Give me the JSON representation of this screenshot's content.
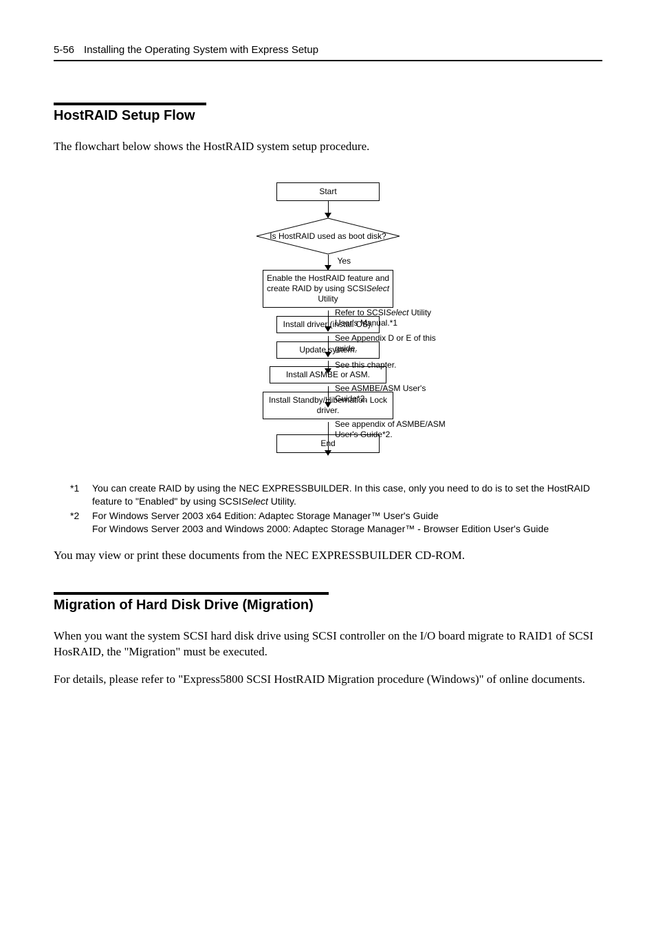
{
  "header": {
    "page_number": "5-56",
    "title": "Installing the Operating System with Express Setup"
  },
  "section1": {
    "heading": "HostRAID Setup Flow",
    "intro": "The flowchart below shows the HostRAID system setup procedure."
  },
  "chart_data": {
    "type": "flowchart",
    "nodes": {
      "start": "Start",
      "decision": "Is HostRAID used as boot disk?",
      "decision_yes": "Yes",
      "enable_pre": "Enable the HostRAID feature and create RAID by using SCSI",
      "enable_ital": "Select",
      "enable_post": " Utility",
      "note1_pre": "Refer to SCSI",
      "note1_ital": "Select",
      "note1_post": " Utility User's Manual.*1",
      "install_driver": "Install driver (install OS).",
      "note2": "See Appendix D or E of this guide.",
      "update": "Update system.",
      "note3": "See this chapter.",
      "asmbe": "Install ASMBE or ASM.",
      "note4": "See ASMBE/ASM User's Guide*2.",
      "standby": "Install Standby/Hibernation Lock driver.",
      "note5": "See appendix of ASMBE/ASM User's Guide*2.",
      "end": "End"
    }
  },
  "footnotes": {
    "f1": {
      "tag": "*1",
      "line1_pre": "You can create RAID by using the NEC EXPRESSBUILDER. In this case, only you need to do is to set the HostRAID feature to \"Enabled\" by using SCSI",
      "line1_ital": "Select",
      "line1_post": " Utility."
    },
    "f2": {
      "tag": "*2",
      "text": "For Windows Server 2003 x64 Edition: Adaptec Storage Manager™  User's Guide\nFor Windows Server 2003 and Windows 2000: Adaptec Storage Manager™ - Browser Edition User's Guide"
    }
  },
  "after_footnotes": "You may view or print these documents from the NEC EXPRESSBUILDER CD-ROM.",
  "section2": {
    "heading": "Migration of Hard Disk Drive (Migration)",
    "p1": "When you want the system SCSI hard disk drive using SCSI controller on the I/O board migrate to RAID1 of SCSI HosRAID, the \"Migration\" must be executed.",
    "p2": "For details, please refer to \"Express5800 SCSI HostRAID Migration procedure (Windows)\" of online documents."
  }
}
